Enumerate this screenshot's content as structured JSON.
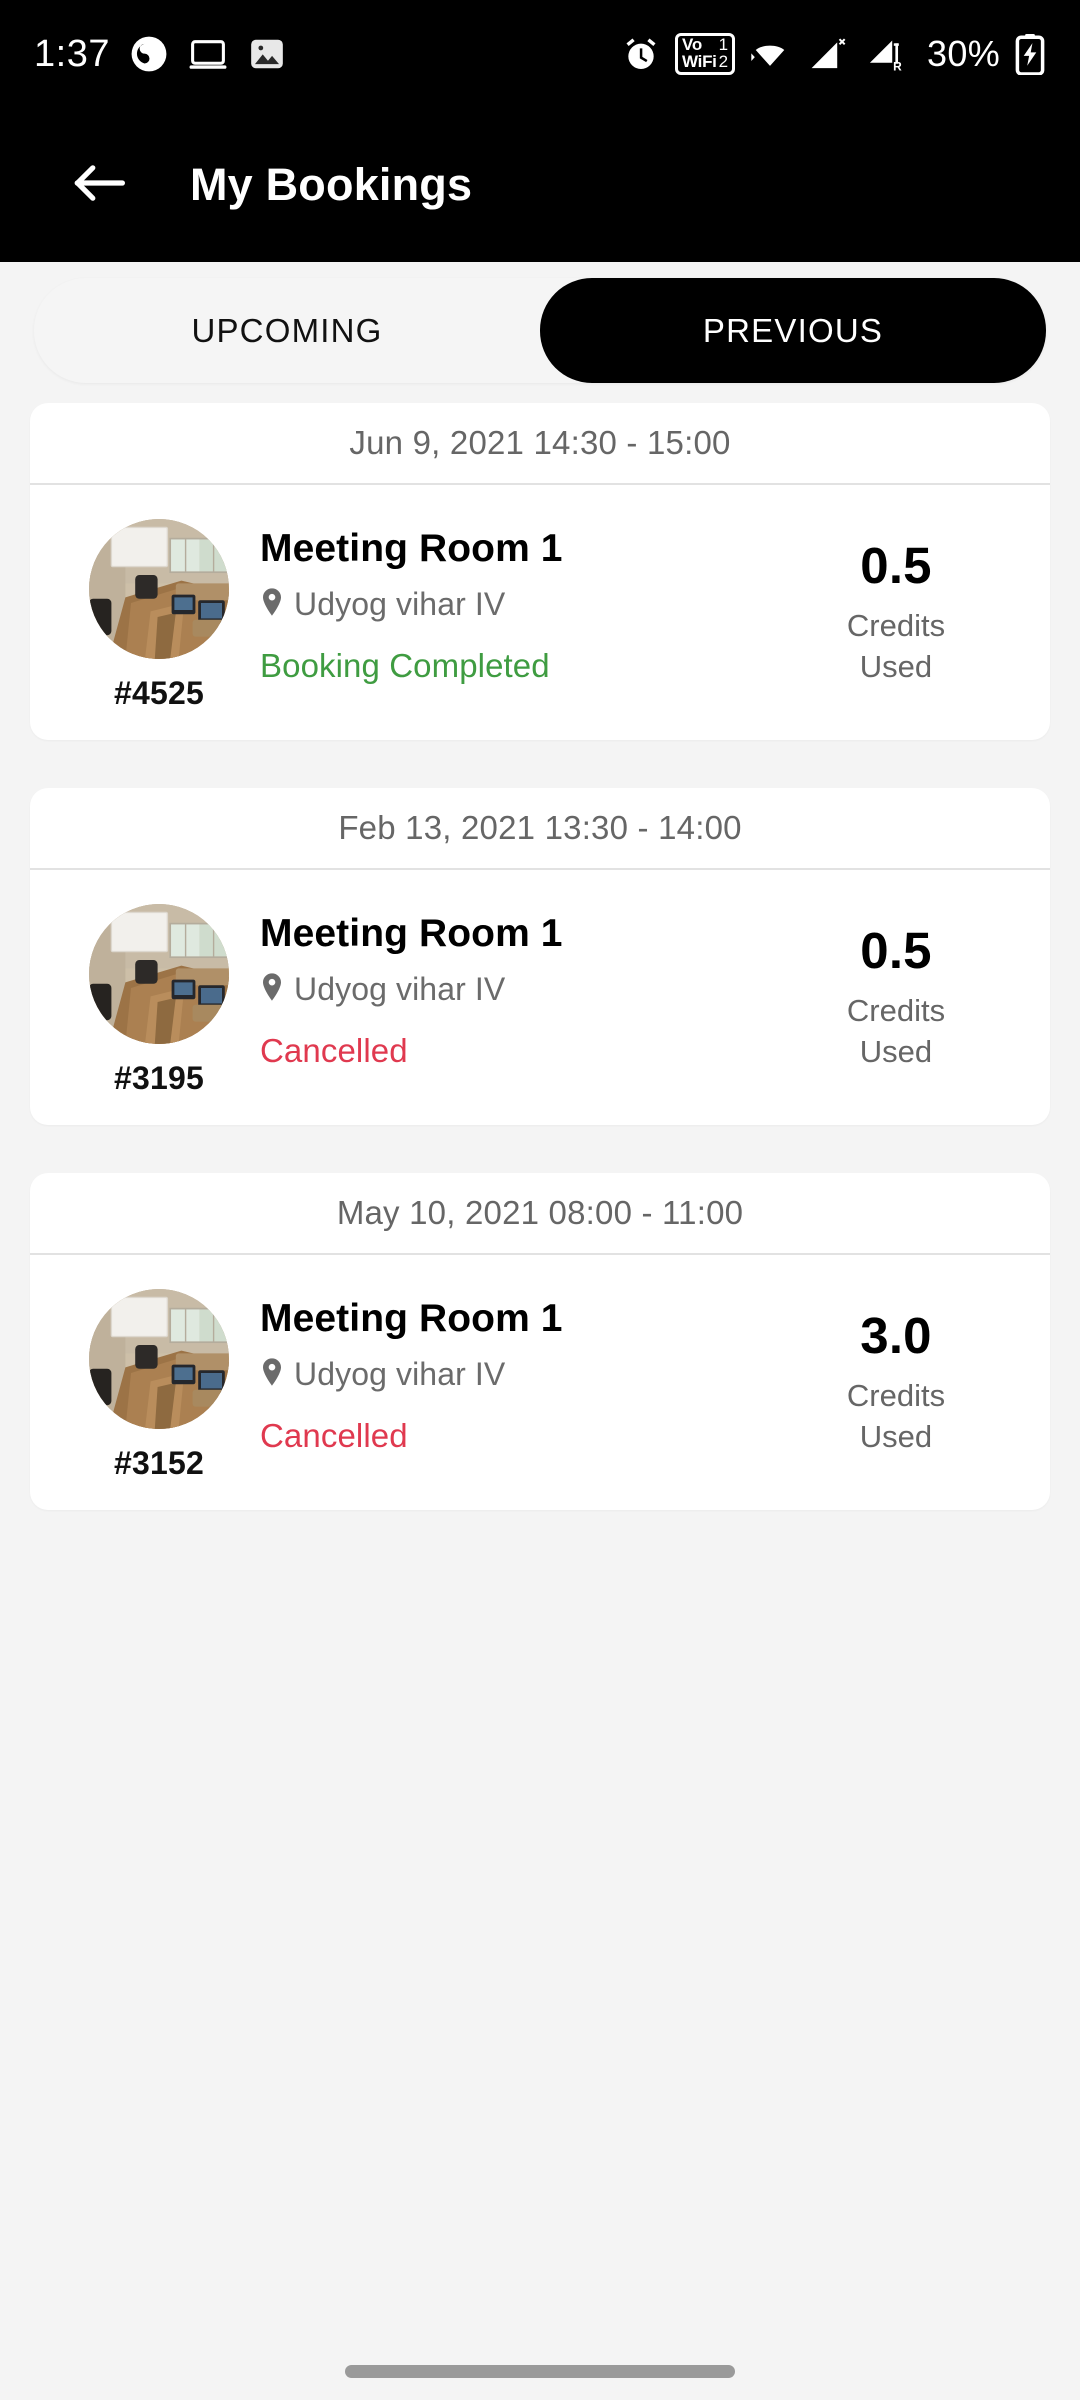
{
  "status_bar": {
    "time": "1:37",
    "icons_left": [
      "app-circle-icon",
      "cast-screen-icon",
      "gallery-image-icon"
    ],
    "icons_right": [
      "alarm-icon",
      "vowifi-icon",
      "wifi-icon",
      "signal-no-service-icon",
      "signal-roaming-icon"
    ],
    "vowifi": {
      "line1": "Vo",
      "line2": "WiFi",
      "slot1": "1",
      "slot2": "2"
    },
    "battery_percent": "30%",
    "battery_state": "charging"
  },
  "app_bar": {
    "back_icon": "arrow-left-icon",
    "title": "My Bookings"
  },
  "tabs": {
    "selected": "PREVIOUS",
    "items": [
      {
        "label": "UPCOMING",
        "selected": false
      },
      {
        "label": "PREVIOUS",
        "selected": true
      }
    ]
  },
  "bookings": [
    {
      "date_range": "Jun 9, 2021 14:30 - 15:00",
      "booking_id": "#4525",
      "room_name": "Meeting Room 1",
      "location": "Udyog vihar IV",
      "status": "Booking Completed",
      "status_type": "completed",
      "credits_value": "0.5",
      "credits_label_line1": "Credits",
      "credits_label_line2": "Used"
    },
    {
      "date_range": "Feb 13, 2021 13:30 - 14:00",
      "booking_id": "#3195",
      "room_name": "Meeting Room 1",
      "location": "Udyog vihar IV",
      "status": "Cancelled",
      "status_type": "cancelled",
      "credits_value": "0.5",
      "credits_label_line1": "Credits",
      "credits_label_line2": "Used"
    },
    {
      "date_range": "May 10, 2021 08:00 - 11:00",
      "booking_id": "#3152",
      "room_name": "Meeting Room 1",
      "location": "Udyog vihar IV",
      "status": "Cancelled",
      "status_type": "cancelled",
      "credits_value": "3.0",
      "credits_label_line1": "Credits",
      "credits_label_line2": "Used"
    }
  ],
  "colors": {
    "status_bar_bg": "#000000",
    "app_bar_bg": "#000000",
    "page_bg": "#f4f4f4",
    "card_bg": "#ffffff",
    "tab_selected_bg": "#000000",
    "tab_track_bg": "#f5f5f5",
    "status_completed": "#3f9c41",
    "status_cancelled": "#e0394f",
    "muted_text": "#666666"
  },
  "gesture_bar": {
    "name": "home-indicator"
  }
}
